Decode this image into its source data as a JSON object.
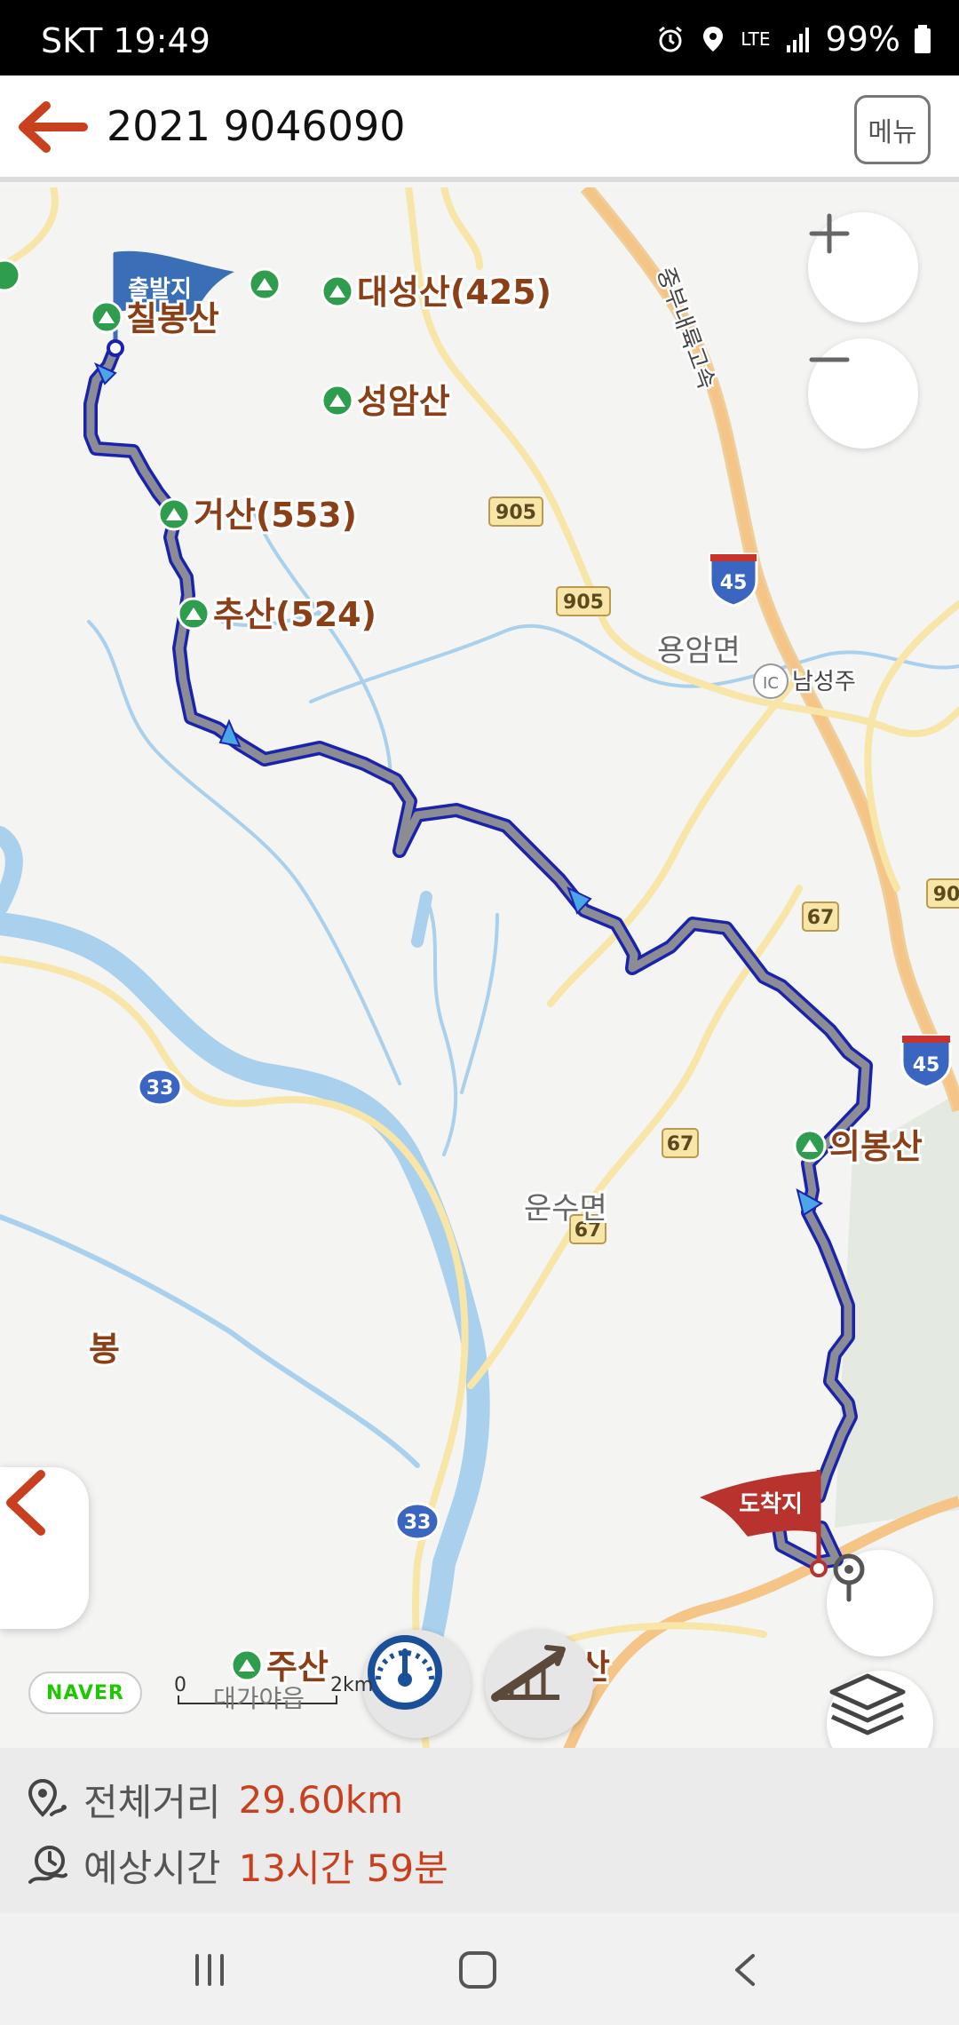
{
  "status_bar": {
    "carrier_time": "SKT 19:49",
    "network": "LTE",
    "battery": "99%"
  },
  "header": {
    "title": "2021 9046090",
    "menu_label": "메뉴"
  },
  "map": {
    "start_flag": "출발지",
    "end_flag": "도착지",
    "peaks": [
      "칠봉산",
      "대성산(425)",
      "성암산",
      "거산(553)",
      "추산(524)",
      "의봉산",
      "주산"
    ],
    "towns": [
      "용암면",
      "운수면",
      "남성주"
    ],
    "partial_labels": [
      "봉",
      "산"
    ],
    "highway": "중부내륙고속",
    "ic_label": "IC",
    "road_numbers": [
      "905",
      "905",
      "45",
      "45",
      "67",
      "67",
      "67",
      "33",
      "33",
      "90"
    ],
    "attribution": "NAVER",
    "scale": {
      "zero": "0",
      "length": "2km",
      "place": "대가야읍"
    }
  },
  "route": {
    "distance_label": "전체거리",
    "distance_value": "29.60km",
    "time_label": "예상시간",
    "time_value": "13시간 59분"
  },
  "colors": {
    "accent": "#c8401e",
    "route_outline": "#1a22b0",
    "route_fill": "#8c8c94",
    "peak_green": "#2e9e4e",
    "start_flag": "#3a6fb8",
    "end_flag": "#b8332e"
  }
}
